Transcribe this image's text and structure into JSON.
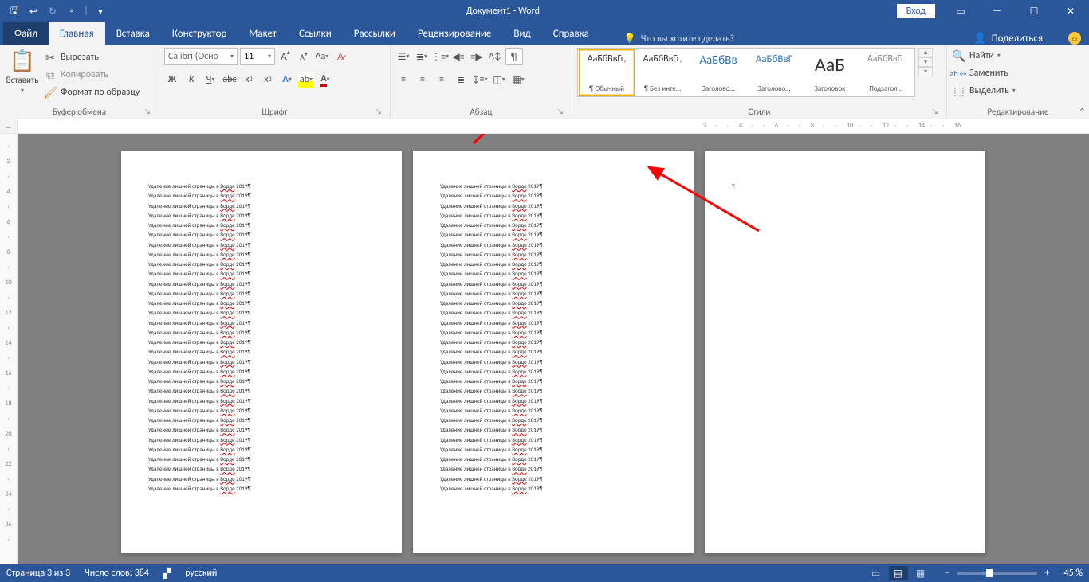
{
  "titlebar": {
    "title": "Документ1  -  Word",
    "login": "Вход"
  },
  "tabs": {
    "file": "Файл",
    "home": "Главная",
    "insert": "Вставка",
    "design": "Конструктор",
    "layout": "Макет",
    "references": "Ссылки",
    "mailings": "Рассылки",
    "review": "Рецензирование",
    "view": "Вид",
    "help": "Справка",
    "tellme": "Что вы хотите сделать?",
    "share": "Поделиться"
  },
  "ribbon": {
    "clipboard": {
      "label": "Буфер обмена",
      "paste": "Вставить",
      "cut": "Вырезать",
      "copy": "Копировать",
      "format_painter": "Формат по образцу"
    },
    "font": {
      "label": "Шрифт",
      "name": "Calibri (Осно",
      "size": "11"
    },
    "paragraph": {
      "label": "Абзац"
    },
    "styles": {
      "label": "Стили",
      "items": [
        {
          "preview": "АаБбВвГг,",
          "name": "¶ Обычный",
          "size": "12px",
          "color": "#333"
        },
        {
          "preview": "АаБбВвГг,",
          "name": "¶ Без инте…",
          "size": "12px",
          "color": "#333"
        },
        {
          "preview": "АаБбВв",
          "name": "Заголово…",
          "size": "15px",
          "color": "#2e74b5"
        },
        {
          "preview": "АаБбВвГ",
          "name": "Заголово…",
          "size": "13px",
          "color": "#2e74b5"
        },
        {
          "preview": "АаБ",
          "name": "Заголовок",
          "size": "24px",
          "color": "#333"
        },
        {
          "preview": "АаБбВвГг",
          "name": "Подзагол…",
          "size": "12px",
          "color": "#888"
        }
      ]
    },
    "editing": {
      "label": "Редактирование",
      "find": "Найти",
      "replace": "Заменить",
      "select": "Выделить"
    }
  },
  "hruler": [
    "2",
    "",
    "",
    "4",
    "",
    "",
    "6",
    "",
    "",
    "8",
    "",
    "",
    "10",
    "",
    "",
    "12",
    "",
    "",
    "14",
    "",
    "",
    "16"
  ],
  "vruler": [
    "",
    "2",
    "",
    "4",
    "",
    "6",
    "",
    "8",
    "",
    "10",
    "",
    "12",
    "",
    "14",
    "",
    "16",
    "",
    "18",
    "",
    "20",
    "",
    "22",
    "",
    "24",
    "",
    "26",
    ""
  ],
  "doc": {
    "line_prefix": "Удаление лишней страницы в ",
    "line_wavy": "Ворде",
    "line_suffix": " 2019¶",
    "line_count": 32
  },
  "statusbar": {
    "page": "Страница 3 из 3",
    "words": "Число слов: 384",
    "lang": "русский",
    "zoom_minus": "−",
    "zoom_plus": "+",
    "zoom_pct": "45 %"
  }
}
